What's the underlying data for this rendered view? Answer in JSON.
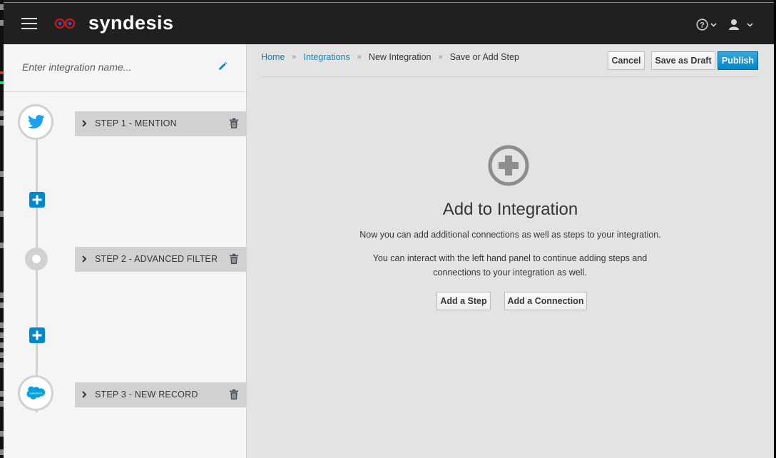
{
  "header": {
    "brand": "syndesis",
    "help_label": "?",
    "user_label": "user"
  },
  "sidebar": {
    "name_placeholder": "Enter integration name...",
    "steps": [
      {
        "label": "STEP 1 - MENTION",
        "icon": "twitter-icon"
      },
      {
        "label": "STEP 2 - ADVANCED FILTER",
        "icon": "filter-node-icon"
      },
      {
        "label": "STEP 3 - NEW RECORD",
        "icon": "salesforce-icon"
      }
    ],
    "salesforce_logo_text": "salesforce"
  },
  "main": {
    "breadcrumb": [
      "Home",
      "Integrations",
      "New Integration",
      "Save or Add Step"
    ],
    "buttons": {
      "cancel": "Cancel",
      "save_draft": "Save as Draft",
      "publish": "Publish"
    },
    "empty_state": {
      "title": "Add to Integration",
      "line1": "Now you can add additional connections as well as steps to your integration.",
      "line2": "You can interact with the left hand panel to continue adding steps and connections to your integration as well.",
      "add_step": "Add a Step",
      "add_connection": "Add a Connection"
    }
  },
  "colors": {
    "accent": "#0088ce",
    "navbar": "#202020",
    "twitter": "#1da1f2",
    "salesforce": "#00a1e0"
  }
}
